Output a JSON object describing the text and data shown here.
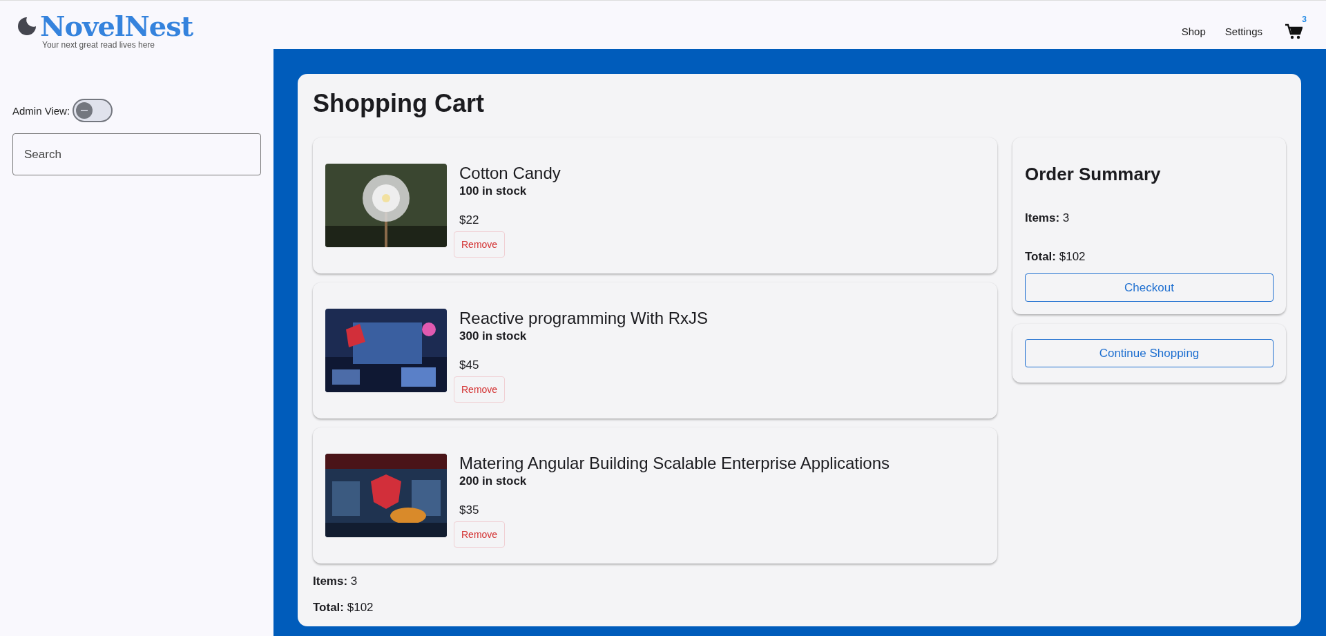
{
  "brand": {
    "name": "NovelNest",
    "tagline": "Your next great read lives here"
  },
  "nav": {
    "links": [
      "Shop",
      "Settings"
    ],
    "cart_count": "3"
  },
  "sidebar": {
    "admin_toggle": {
      "label": "Admin View:",
      "on": false
    },
    "search": {
      "placeholder": "Search"
    }
  },
  "cart": {
    "title": "Shopping Cart",
    "items": [
      {
        "title": "Cotton Candy",
        "stock": "100 in stock",
        "price": "$22",
        "remove": "Remove"
      },
      {
        "title": "Reactive programming With RxJS",
        "stock": "300 in stock",
        "price": "$45",
        "remove": "Remove"
      },
      {
        "title": "Matering Angular Building Scalable Enterprise Applications",
        "stock": "200 in stock",
        "price": "$35",
        "remove": "Remove"
      }
    ],
    "footer": [
      "**Items:** 3",
      "**Total:** $102"
    ]
  },
  "summary": {
    "title": "Order Summary",
    "lines": [
      "**Items:** 3",
      "**Total:** $102"
    ],
    "checkout": "Checkout",
    "continue": "Continue Shopping"
  }
}
